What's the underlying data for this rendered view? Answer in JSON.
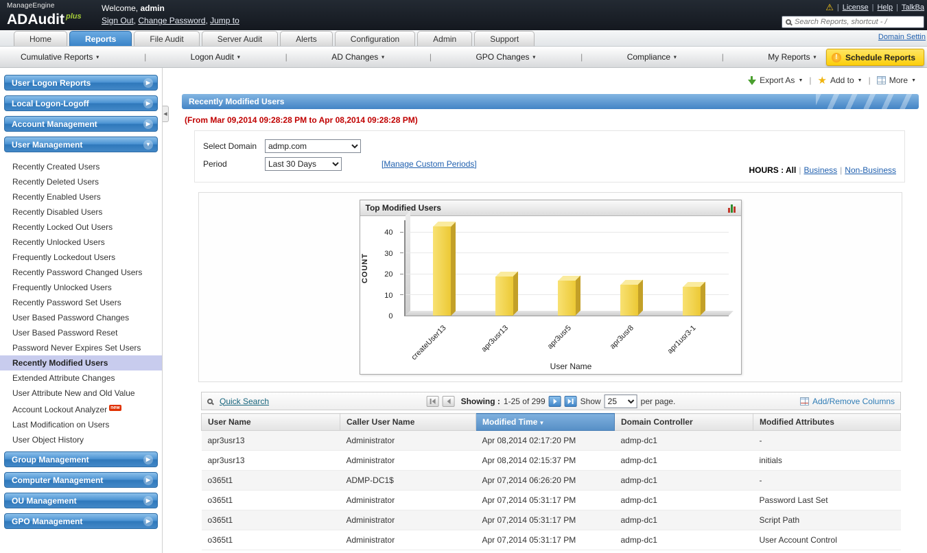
{
  "colors": {
    "header_bg": "#171b22",
    "active_tab_blue": "#3c86c9",
    "sidebar_header_blue": "#4a92d2",
    "selected_item_bg": "#c8ccee",
    "schedule_button_yellow": "#fccf0a",
    "report_header_blue": "#5d9bd3",
    "bar_yellow": "#efcf3e",
    "link_blue": "#1f5fae",
    "period_red": "#c00000",
    "sorted_header_blue": "#568fc6"
  },
  "header": {
    "brand_top": "ManageEngine",
    "brand_main": "ADAudit",
    "brand_plus": "plus",
    "welcome_label": "Welcome,",
    "username": "admin",
    "session_links": [
      "Sign Out",
      "Change Password",
      "Jump to"
    ],
    "utility_links": [
      "License",
      "Help",
      "TalkBa"
    ],
    "search_placeholder": "Search Reports, shortcut - /"
  },
  "tabs": {
    "items": [
      {
        "label": "Home",
        "active": false
      },
      {
        "label": "Reports",
        "active": true
      },
      {
        "label": "File Audit",
        "active": false
      },
      {
        "label": "Server Audit",
        "active": false
      },
      {
        "label": "Alerts",
        "active": false
      },
      {
        "label": "Configuration",
        "active": false
      },
      {
        "label": "Admin",
        "active": false
      },
      {
        "label": "Support",
        "active": false
      }
    ],
    "right_link": "Domain Settin"
  },
  "menubar": {
    "items": [
      "Cumulative Reports",
      "Logon Audit",
      "AD Changes",
      "GPO Changes",
      "Compliance",
      "My Reports"
    ],
    "schedule_button": "Schedule Reports"
  },
  "sidebar": {
    "sections": [
      {
        "label": "User Logon Reports",
        "expanded": false
      },
      {
        "label": "Local Logon-Logoff",
        "expanded": false
      },
      {
        "label": "Account Management",
        "expanded": false
      },
      {
        "label": "User Management",
        "expanded": true,
        "items": [
          {
            "label": "Recently Created Users"
          },
          {
            "label": "Recently Deleted Users"
          },
          {
            "label": "Recently Enabled Users"
          },
          {
            "label": "Recently Disabled Users"
          },
          {
            "label": "Recently Locked Out Users"
          },
          {
            "label": "Recently Unlocked Users"
          },
          {
            "label": "Frequently Lockedout Users"
          },
          {
            "label": "Recently Password Changed Users"
          },
          {
            "label": "Frequently Unlocked Users"
          },
          {
            "label": "Recently Password Set Users"
          },
          {
            "label": "User Based Password Changes"
          },
          {
            "label": "User Based Password Reset"
          },
          {
            "label": "Password Never Expires Set Users"
          },
          {
            "label": "Recently Modified Users",
            "selected": true
          },
          {
            "label": "Extended Attribute Changes"
          },
          {
            "label": "User Attribute New and Old Value"
          },
          {
            "label": "Account Lockout Analyzer",
            "badge": "new"
          },
          {
            "label": "Last Modification on Users"
          },
          {
            "label": "User Object History"
          }
        ]
      },
      {
        "label": "Group Management",
        "expanded": false
      },
      {
        "label": "Computer Management",
        "expanded": false
      },
      {
        "label": "OU Management",
        "expanded": false
      },
      {
        "label": "GPO Management",
        "expanded": false
      }
    ]
  },
  "actions": {
    "export_label": "Export As",
    "add_to_label": "Add to",
    "more_label": "More"
  },
  "report": {
    "title": "Recently Modified Users",
    "period_text": "(From Mar 09,2014 09:28:28 PM to Apr 08,2014 09:28:28 PM)",
    "select_domain_label": "Select Domain",
    "domain_value": "admp.com",
    "period_label": "Period",
    "period_value": "Last 30 Days",
    "manage_custom_periods": "[Manage Custom Periods]",
    "hours_label": "HOURS : All",
    "hours_links": [
      "Business",
      "Non-Business"
    ]
  },
  "chart_data": {
    "type": "bar",
    "title": "Top Modified Users",
    "categories": [
      "createUser13",
      "apr3usr13",
      "apr3usr5",
      "apr3usr8",
      "apr1usr3-1"
    ],
    "values": [
      43,
      19,
      17,
      15,
      14
    ],
    "xlabel": "User Name",
    "ylabel": "COUNT",
    "ylim": [
      0,
      46
    ],
    "yticks": [
      0,
      10,
      20,
      30,
      40
    ],
    "grid": true,
    "legend": false
  },
  "table": {
    "quick_search": "Quick Search",
    "paging": {
      "showing_label": "Showing :",
      "range": "1-25 of 299",
      "show_label": "Show",
      "page_size": "25",
      "per_page": "per page."
    },
    "add_remove_columns": "Add/Remove Columns",
    "columns": [
      "User Name",
      "Caller User Name",
      "Modified Time",
      "Domain Controller",
      "Modified Attributes"
    ],
    "sorted_column": "Modified Time",
    "rows": [
      [
        "apr3usr13",
        "Administrator",
        "Apr 08,2014 02:17:20 PM",
        "admp-dc1",
        "-"
      ],
      [
        "apr3usr13",
        "Administrator",
        "Apr 08,2014 02:15:37 PM",
        "admp-dc1",
        "initials"
      ],
      [
        "o365t1",
        "ADMP-DC1$",
        "Apr 07,2014 06:26:20 PM",
        "admp-dc1",
        "-"
      ],
      [
        "o365t1",
        "Administrator",
        "Apr 07,2014 05:31:17 PM",
        "admp-dc1",
        "Password Last Set"
      ],
      [
        "o365t1",
        "Administrator",
        "Apr 07,2014 05:31:17 PM",
        "admp-dc1",
        "Script Path"
      ],
      [
        "o365t1",
        "Administrator",
        "Apr 07,2014 05:31:17 PM",
        "admp-dc1",
        "User Account Control"
      ]
    ]
  }
}
